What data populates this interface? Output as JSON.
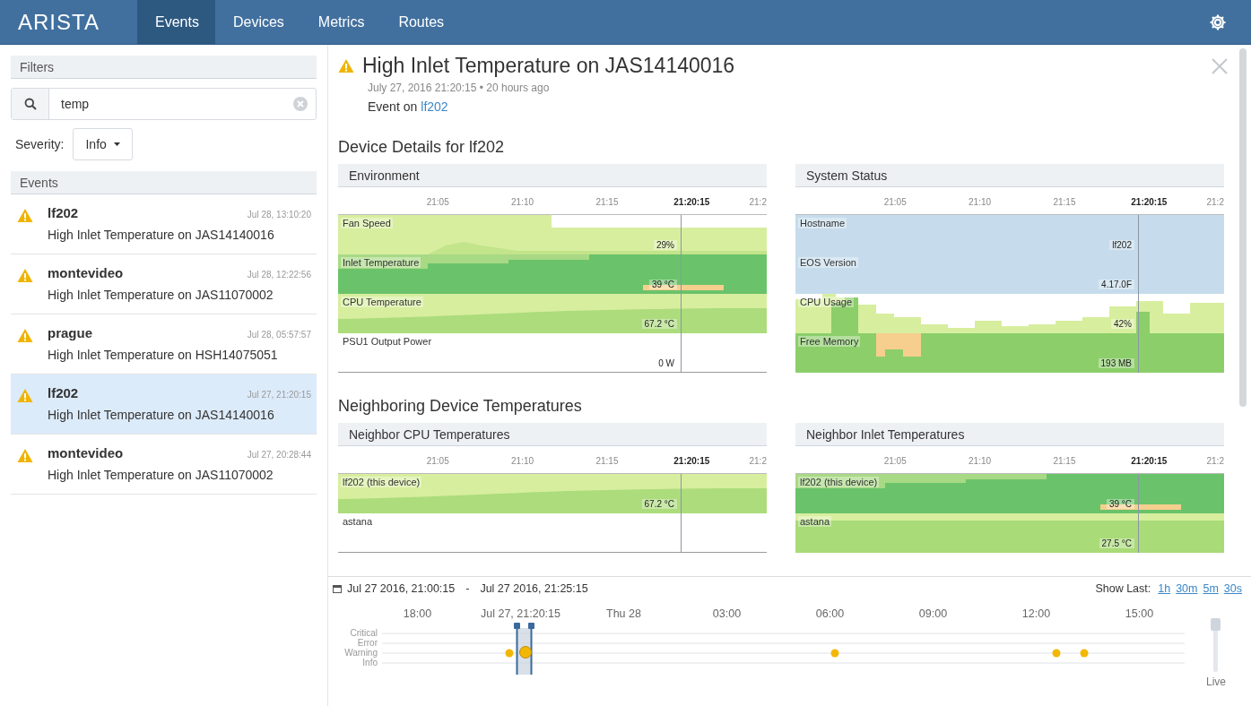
{
  "nav": {
    "logo": "ARISTA",
    "tabs": [
      {
        "label": "Events",
        "selected": true
      },
      {
        "label": "Devices",
        "selected": false
      },
      {
        "label": "Metrics",
        "selected": false
      },
      {
        "label": "Routes",
        "selected": false
      }
    ]
  },
  "sidebar": {
    "filters_title": "Filters",
    "search": {
      "value": "temp"
    },
    "severity_label": "Severity:",
    "severity_value": "Info",
    "events_title": "Events",
    "events": [
      {
        "device": "lf202",
        "time": "Jul 28, 13:10:20",
        "message": "High Inlet Temperature on JAS14140016",
        "selected": false
      },
      {
        "device": "montevideo",
        "time": "Jul 28, 12:22:56",
        "message": "High Inlet Temperature on JAS11070002",
        "selected": false
      },
      {
        "device": "prague",
        "time": "Jul 28, 05:57:57",
        "message": "High Inlet Temperature on HSH14075051",
        "selected": false
      },
      {
        "device": "lf202",
        "time": "Jul 27, 21:20:15",
        "message": "High Inlet Temperature on JAS14140016",
        "selected": true
      },
      {
        "device": "montevideo",
        "time": "Jul 27, 20:28:44",
        "message": "High Inlet Temperature on JAS11070002",
        "selected": false
      }
    ]
  },
  "detail": {
    "title": "High Inlet Temperature on JAS14140016",
    "subtitle": "July 27, 2016 21:20:15 • 20 hours ago",
    "event_on": "Event on",
    "device_link": "lf202",
    "sections": [
      {
        "heading": "Device Details for lf202",
        "panels": [
          {
            "title": "Environment",
            "ticks": [
              {
                "label": "21:05",
                "current": false
              },
              {
                "label": "21:10",
                "current": false
              },
              {
                "label": "21:15",
                "current": false
              },
              {
                "label": "21:20:15",
                "current": true
              },
              {
                "label": "21:2",
                "current": false
              }
            ],
            "rows": [
              {
                "label": "Fan Speed",
                "reading": "29%",
                "kind": "partial"
              },
              {
                "label": "Inlet Temperature",
                "reading": "39 °C",
                "kind": "high"
              },
              {
                "label": "CPU Temperature",
                "reading": "67.2 °C",
                "kind": "mid"
              },
              {
                "label": "PSU1 Output Power",
                "reading": "0 W",
                "kind": "empty"
              }
            ]
          },
          {
            "title": "System Status",
            "ticks": [
              {
                "label": "21:05",
                "current": false
              },
              {
                "label": "21:10",
                "current": false
              },
              {
                "label": "21:15",
                "current": false
              },
              {
                "label": "21:20:15",
                "current": true
              },
              {
                "label": "21:2",
                "current": false
              }
            ],
            "rows": [
              {
                "label": "Hostname",
                "reading": "lf202",
                "kind": "status"
              },
              {
                "label": "EOS Version",
                "reading": "4.17.0F",
                "kind": "status"
              },
              {
                "label": "CPU Usage",
                "reading": "42%",
                "kind": "usage"
              },
              {
                "label": "Free Memory",
                "reading": "193 MB",
                "kind": "memory"
              }
            ]
          }
        ]
      },
      {
        "heading": "Neighboring Device Temperatures",
        "panels": [
          {
            "title": "Neighbor CPU Temperatures",
            "ticks": [
              {
                "label": "21:05",
                "current": false
              },
              {
                "label": "21:10",
                "current": false
              },
              {
                "label": "21:15",
                "current": false
              },
              {
                "label": "21:20:15",
                "current": true
              },
              {
                "label": "21:2",
                "current": false
              }
            ],
            "rows": [
              {
                "label": "lf202 (this device)",
                "reading": "67.2 °C",
                "kind": "mid"
              },
              {
                "label": "astana",
                "kind": "empty"
              }
            ]
          },
          {
            "title": "Neighbor Inlet Temperatures",
            "ticks": [
              {
                "label": "21:05",
                "current": false
              },
              {
                "label": "21:10",
                "current": false
              },
              {
                "label": "21:15",
                "current": false
              },
              {
                "label": "21:20:15",
                "current": true
              },
              {
                "label": "21:2",
                "current": false
              }
            ],
            "rows": [
              {
                "label": "lf202 (this device)",
                "reading": "39 °C",
                "kind": "high"
              },
              {
                "label": "astana",
                "reading": "27.5 °C",
                "kind": "low"
              }
            ]
          }
        ]
      }
    ]
  },
  "timeline": {
    "range_start": "Jul 27 2016, 21:00:15",
    "range_sep": "-",
    "range_end": "Jul 27 2016, 21:25:15",
    "show_last_label": "Show Last:",
    "show_last": [
      "1h",
      "30m",
      "5m",
      "30s"
    ],
    "axis": [
      "18:00",
      "Jul 27, 21:20:15",
      "Thu 28",
      "03:00",
      "06:00",
      "09:00",
      "12:00",
      "15:00"
    ],
    "levels": [
      "Critical",
      "Error",
      "Warning",
      "Info"
    ],
    "live": {
      "label": "Live",
      "level": 1
    }
  }
}
